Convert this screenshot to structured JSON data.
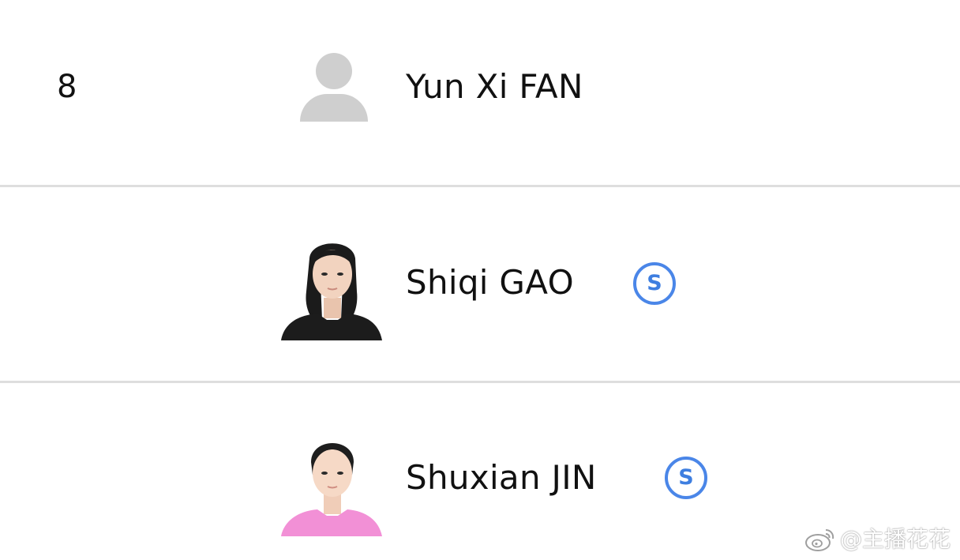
{
  "athletes": [
    {
      "rank": "8",
      "name": "Yun Xi FAN",
      "avatar": "default-user-icon"
    },
    {
      "rank": "",
      "name": "Shiqi GAO",
      "avatar": "athlete-photo",
      "badge": "S"
    },
    {
      "rank": "",
      "name": "Shuxian JIN",
      "avatar": "athlete-photo",
      "badge": "S"
    }
  ],
  "colors": {
    "badge": "#4a86e8",
    "divider": "#dedede",
    "placeholder_avatar": "#cfcfcf",
    "shirt_row2": "#1c1c1c",
    "shirt_row3": "#f290d6"
  },
  "watermark": {
    "text": "@主播花花",
    "icon": "weibo-logo-icon"
  }
}
